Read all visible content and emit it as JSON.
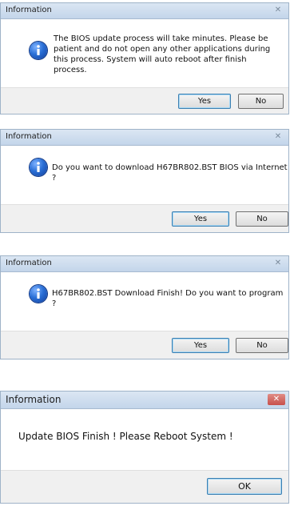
{
  "dialogs": [
    {
      "title": "Information",
      "message": "The BIOS update process will take minutes. Please be patient and do not open any other applications during this process.  System will auto reboot after finish process.",
      "buttons": [
        "Yes",
        "No"
      ],
      "close_glyph": "✕"
    },
    {
      "title": "Information",
      "message": "Do you want to download H67BR802.BST BIOS via Internet ?",
      "buttons": [
        "Yes",
        "No"
      ],
      "close_glyph": "✕"
    },
    {
      "title": "Information",
      "message": "H67BR802.BST Download Finish! Do you want to program ?",
      "buttons": [
        "Yes",
        "No"
      ],
      "close_glyph": "✕"
    },
    {
      "title": "Information",
      "message": "Update BIOS Finish ! Please Reboot System !",
      "buttons": [
        "OK"
      ],
      "close_glyph": "✕"
    }
  ],
  "colors": {
    "titlebar": "#c3d5ea",
    "close_active": "#c7504b",
    "info_icon": "#2a6fd6",
    "footer": "#f0f0f0"
  },
  "icons": [
    "info-icon",
    "close-icon"
  ]
}
